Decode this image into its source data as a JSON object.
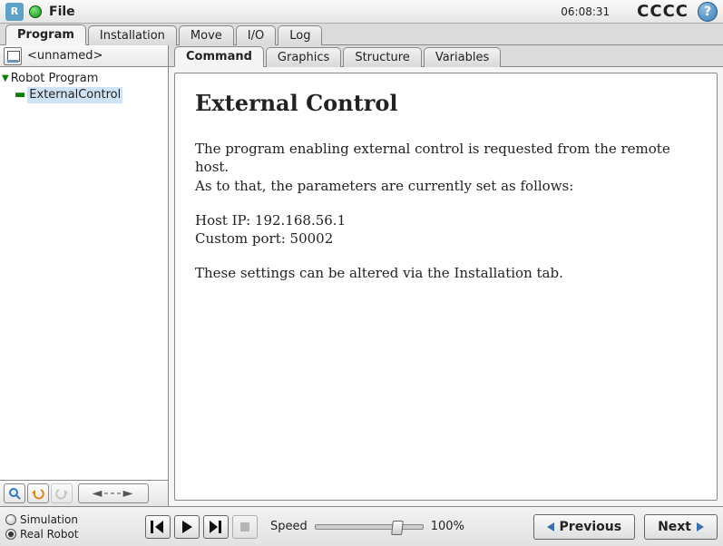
{
  "header": {
    "file_menu": "File",
    "clock": "06:08:31",
    "status": "CCCC",
    "help": "?"
  },
  "tabs": {
    "main": [
      "Program",
      "Installation",
      "Move",
      "I/O",
      "Log"
    ],
    "main_active": 0,
    "sub": [
      "Command",
      "Graphics",
      "Structure",
      "Variables"
    ],
    "sub_active": 0
  },
  "program": {
    "name": "<unnamed>",
    "tree": {
      "root": "Robot Program",
      "child": "ExternalControl"
    }
  },
  "left_toolbar": {
    "dashes": "◄---►"
  },
  "content": {
    "title": "External Control",
    "p1": "The program enabling external control is requested from the remote host.",
    "p2": "As to that, the parameters are currently set as follows:",
    "host_line": "Host IP: 192.168.56.1",
    "port_line": "Custom port: 50002",
    "p3": "These settings can be altered via the Installation tab."
  },
  "bottom": {
    "radio1": "Simulation",
    "radio2": "Real Robot",
    "radio_selected": 1,
    "speed_label": "Speed",
    "speed_value": "100%",
    "prev": "Previous",
    "next": "Next"
  }
}
